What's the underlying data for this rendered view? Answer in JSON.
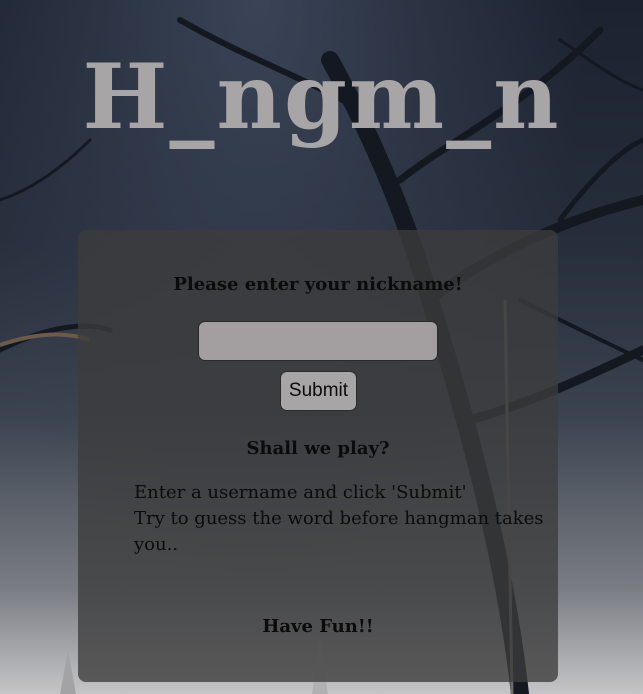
{
  "header": {
    "title": "H_ngm_n"
  },
  "form": {
    "prompt": "Please enter your nickname!",
    "nickname_value": "",
    "nickname_placeholder": "",
    "submit_label": "Submit"
  },
  "info": {
    "heading": "Shall we play?",
    "lines": [
      "Enter a username and click 'Submit'",
      "Try to guess the word before hangman takes you.."
    ],
    "footer": "Have Fun!!"
  },
  "colors": {
    "title": "#a7a5a6",
    "panel": "#3c3c3c",
    "input_bg": "#a39fa0",
    "button_bg": "#a8a5a6",
    "text": "#0b0b0b"
  }
}
